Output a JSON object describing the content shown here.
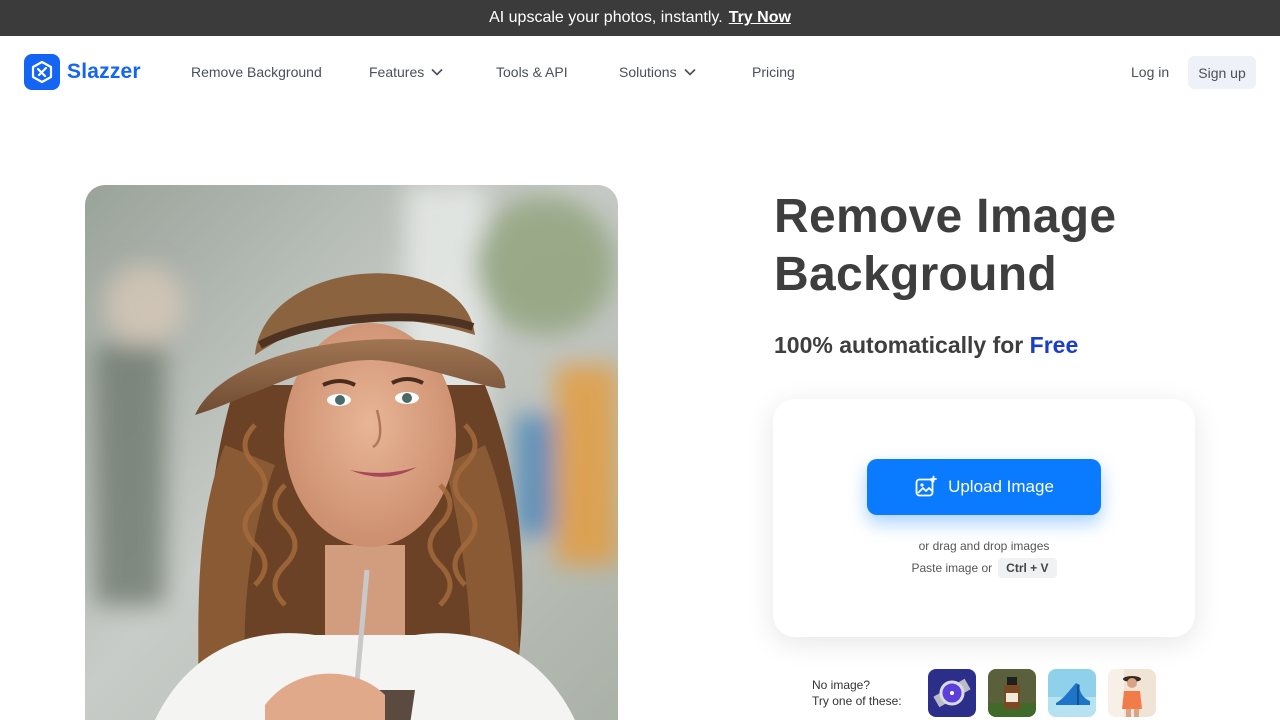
{
  "promo": {
    "text": "AI upscale your photos, instantly.",
    "link": "Try Now"
  },
  "brand": {
    "name": "Slazzer",
    "color": "#1565f5"
  },
  "nav": {
    "remove_background": "Remove Background",
    "features": "Features",
    "tools_api": "Tools & API",
    "solutions": "Solutions",
    "pricing": "Pricing"
  },
  "auth": {
    "login": "Log in",
    "signup": "Sign up"
  },
  "hero": {
    "title_line1": "Remove Image",
    "title_line2": "Background",
    "subtitle_prefix": "100% automatically for",
    "subtitle_highlight": "Free"
  },
  "upload": {
    "button_label": "Upload Image",
    "drag_text": "or drag and drop images",
    "paste_text": "Paste image or",
    "shortcut": "Ctrl + V"
  },
  "samples": {
    "line1": "No image?",
    "line2": "Try one of these:",
    "items": [
      "watch",
      "bottle",
      "shoe",
      "person"
    ]
  },
  "colors": {
    "accent": "#0a7bff",
    "free_highlight": "#1a3ec9",
    "promo_bg": "#3b3b3b"
  }
}
